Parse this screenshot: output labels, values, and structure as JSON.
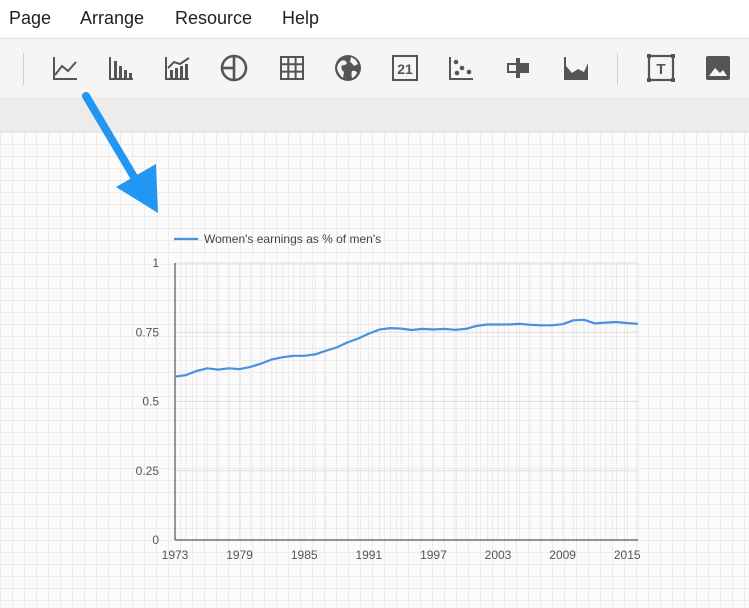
{
  "menu": {
    "items": [
      {
        "label": "Page"
      },
      {
        "label": "Arrange"
      },
      {
        "label": "Resource"
      },
      {
        "label": "Help"
      }
    ]
  },
  "toolbar": {
    "icons": [
      "line-chart-icon",
      "bar-chart-icon",
      "combo-chart-icon",
      "pie-chart-icon",
      "table-icon",
      "geo-map-icon",
      "scorecard-icon",
      "scatter-chart-icon",
      "bullet-chart-icon",
      "area-chart-icon",
      "text-box-icon",
      "image-icon"
    ],
    "scorecard_glyph": "21",
    "text_glyph": "T"
  },
  "annotation": {
    "arrow_color": "#2196F3"
  },
  "chart_data": {
    "type": "line",
    "title": "",
    "xlabel": "",
    "ylabel": "",
    "xlim": [
      1973,
      2016
    ],
    "ylim": [
      0,
      1
    ],
    "x_ticks": [
      "1973",
      "1979",
      "1985",
      "1991",
      "1997",
      "2003",
      "2009",
      "2015"
    ],
    "y_ticks": [
      "0",
      "0.25",
      "0.5",
      "0.75",
      "1"
    ],
    "grid": true,
    "legend_position": "top-left",
    "series": [
      {
        "name": "Women's earnings as % of men's",
        "color": "#4a90e2",
        "x": [
          1973,
          1974,
          1975,
          1976,
          1977,
          1978,
          1979,
          1980,
          1981,
          1982,
          1983,
          1984,
          1985,
          1986,
          1987,
          1988,
          1989,
          1990,
          1991,
          1992,
          1993,
          1994,
          1995,
          1996,
          1997,
          1998,
          1999,
          2000,
          2001,
          2002,
          2003,
          2004,
          2005,
          2006,
          2007,
          2008,
          2009,
          2010,
          2011,
          2012,
          2013,
          2014,
          2015,
          2016
        ],
        "values": [
          0.59,
          0.595,
          0.61,
          0.62,
          0.615,
          0.62,
          0.617,
          0.625,
          0.637,
          0.652,
          0.66,
          0.665,
          0.665,
          0.67,
          0.683,
          0.695,
          0.713,
          0.727,
          0.745,
          0.76,
          0.765,
          0.763,
          0.758,
          0.762,
          0.76,
          0.762,
          0.759,
          0.762,
          0.773,
          0.778,
          0.778,
          0.778,
          0.78,
          0.777,
          0.775,
          0.775,
          0.779,
          0.793,
          0.795,
          0.782,
          0.785,
          0.787,
          0.783,
          0.78
        ]
      }
    ]
  }
}
